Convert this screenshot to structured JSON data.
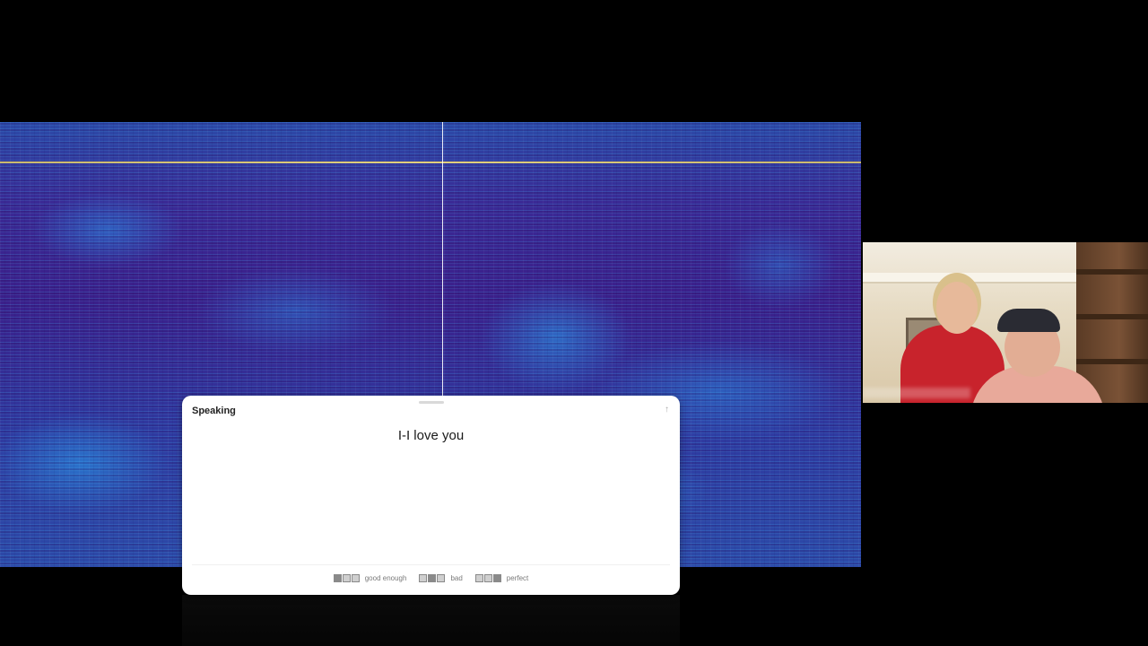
{
  "speaking_panel": {
    "title": "Speaking",
    "transcript": "I-I love you",
    "collapse_icon": "chevron-up-icon",
    "ratings": [
      {
        "label": "good enough"
      },
      {
        "label": "bad"
      },
      {
        "label": "perfect"
      }
    ]
  },
  "colors": {
    "background": "#000000",
    "spectrogram_base": "#3c1a86",
    "spectrogram_highlight": "#2896e6",
    "band_line": "#f3e27a",
    "card": "#ffffff"
  }
}
